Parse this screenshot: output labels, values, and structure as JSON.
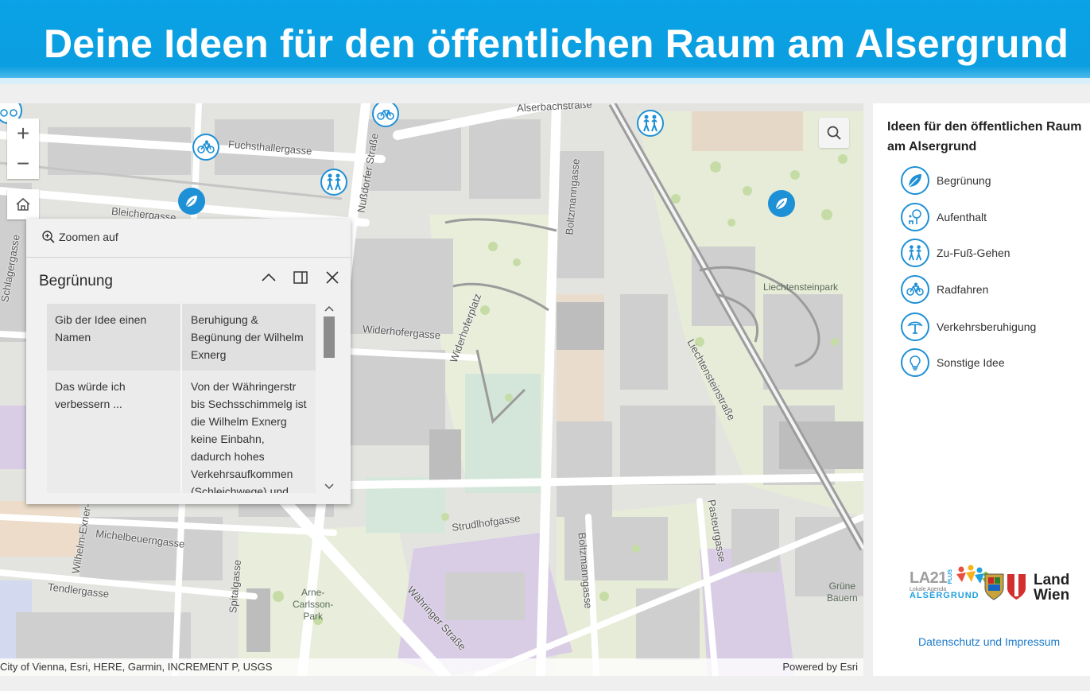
{
  "header": {
    "title": "Deine Ideen für den öffentlichen Raum am Alsergrund"
  },
  "map": {
    "attribution": "City of Vienna, Esri, HERE, Garmin, INCREMENT P, USGS",
    "powered_by": "Powered by Esri",
    "zoom_in": "+",
    "zoom_out": "−",
    "streets": {
      "fuchsthallergasse": "Fuchsthallergasse",
      "nussdorfer": "Nußdorfer Straße",
      "alserbachstrasse": "Alserbachstraße",
      "bleichergasse": "Bleichergasse",
      "boltzmanngasse_top": "Boltzmanngasse",
      "widerhofergasse": "Widerhofergasse",
      "widerhoferplatz": "Widerhoferplatz",
      "liechtensteinstrasse": "Liechtensteinstraße",
      "schlagergasse": "Schlagergasse",
      "michelbeuerngasse": "Michelbeuerngasse",
      "wilhelm_exner": "Wilhelm-Exner-",
      "tendlergasse": "Tendlergasse",
      "spitalgasse": "Spitalgasse",
      "struedlhofgasse": "Strudlhofgasse",
      "boltzmanngasse_bottom": "Boltzmanngasse",
      "waehringer": "Währinger Straße",
      "pasteurgasse": "Pasteurgasse"
    },
    "parks": {
      "liechtensteinpark": "Liechtensteinpark",
      "arne_carlsson_1": "Arne-",
      "arne_carlsson_2": "Carlsson-",
      "arne_carlsson_3": "Park",
      "bauernfeld_1": "Grüne",
      "bauernfeld_2": "Bauern"
    }
  },
  "popup": {
    "zoom_label": "Zoomen auf",
    "title": "Begrünung",
    "rows": [
      {
        "label": "Gib der Idee einen Namen",
        "value": "Beruhigung & Begünung der Wilhelm Exnerg"
      },
      {
        "label": "Das würde ich verbessern ...",
        "value": "Von der Währingerstr bis Sechsschimmelg ist die Wilhelm Exnerg keine Einbahn, dadurch hohes Verkehrsaufkommen (Schleichwege) und"
      }
    ]
  },
  "panel": {
    "title": "Ideen für den öffentlichen Raum am Alsergrund",
    "legend": [
      {
        "label": "Begrünung",
        "icon": "leaf-icon"
      },
      {
        "label": "Aufenthalt",
        "icon": "tree-bench-icon"
      },
      {
        "label": "Zu-Fuß-Gehen",
        "icon": "pedestrians-icon"
      },
      {
        "label": "Radfahren",
        "icon": "bicycle-icon"
      },
      {
        "label": "Verkehrsberuhigung",
        "icon": "traffic-calming-icon"
      },
      {
        "label": "Sonstige Idee",
        "icon": "lightbulb-icon"
      }
    ],
    "logo_la21": "LA21",
    "logo_la21_plus": "PLUS",
    "logo_la21_agenda": "Lokale Agenda",
    "logo_la21_district": "ALSERGRUND",
    "logo_wien_1": "Land",
    "logo_wien_2": "Wien",
    "footer_link": "Datenschutz  und Impressum"
  },
  "colors": {
    "header": "#0aa3e6",
    "marker": "#1e90d6",
    "link": "#1c79c8"
  }
}
